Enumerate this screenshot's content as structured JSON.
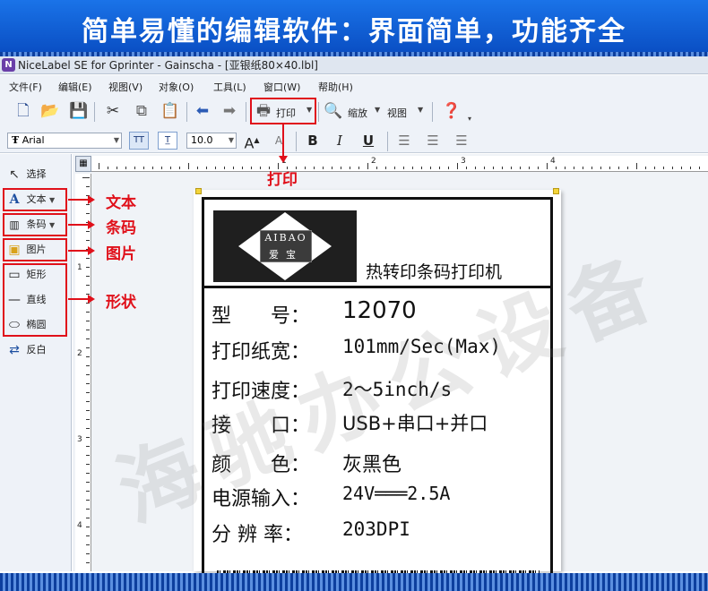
{
  "banner": {
    "title": "简单易懂的编辑软件：界面简单，功能齐全"
  },
  "window": {
    "title": "NiceLabel SE for Gprinter - Gainscha - [亚银纸80×40.lbl]"
  },
  "menu": [
    "文件(F)",
    "编辑(E)",
    "视图(V)",
    "对象(O)",
    "工具(L)",
    "窗口(W)",
    "帮助(H)"
  ],
  "toolbar": {
    "print_label": "打印",
    "zoom_label": "缩放",
    "view_label": "视图",
    "font_name": "Arial",
    "font_size": "10.0"
  },
  "tools": {
    "select": "选择",
    "text": "文本",
    "barcode": "条码",
    "image": "图片",
    "rect": "矩形",
    "line": "直线",
    "ellipse": "椭圆",
    "invert": "反白"
  },
  "annotations": {
    "print": "打印",
    "text": "文本",
    "barcode": "条码",
    "image": "图片",
    "shape": "形状"
  },
  "ruler": {
    "h_numbers": [
      "1",
      "2",
      "3",
      "4"
    ],
    "v_numbers": [
      "1",
      "2",
      "3",
      "4"
    ]
  },
  "label": {
    "logo_text": "AIBAO",
    "logo_sub": "爱宝",
    "title": "热转印条码打印机",
    "specs": [
      {
        "label": "型　　号：",
        "value": "12070"
      },
      {
        "label": "打印纸宽：",
        "value": "101mm/Sec(Max)"
      },
      {
        "label": "打印速度：",
        "value": "2～5inch/s"
      },
      {
        "label": "接　　口：",
        "value": "USB+串口+并口"
      },
      {
        "label": "颜　　色：",
        "value": "灰黑色"
      },
      {
        "label": "电源输入：",
        "value": "24V═══2.5A"
      },
      {
        "label": "分 辨 率：",
        "value": "203DPI"
      }
    ]
  },
  "watermark": "海驰办公设备",
  "colors": {
    "banner": "#1a73e8",
    "annotation": "#e0101a"
  }
}
